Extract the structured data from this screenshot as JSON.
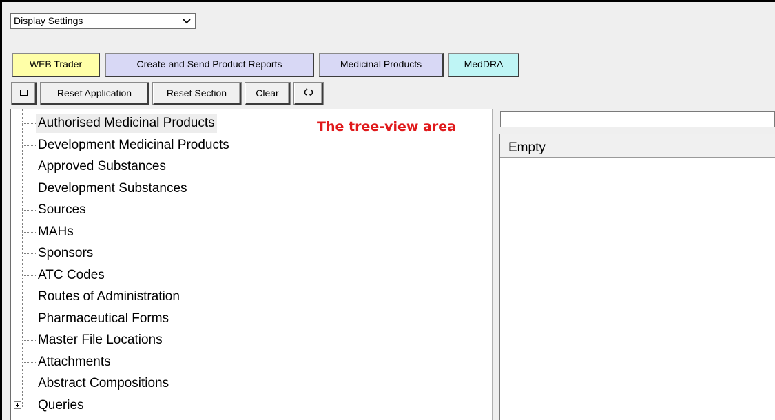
{
  "display_select": {
    "value": "Display Settings",
    "icon": "chevron-down-icon"
  },
  "tabs": [
    {
      "label": "WEB Trader",
      "bg": "#ffffa8"
    },
    {
      "label": "Create and Send Product Reports",
      "bg": "#d8d8f5"
    },
    {
      "label": "Medicinal Products",
      "bg": "#d8d8f5"
    },
    {
      "label": "MedDRA",
      "bg": "#bff5f5"
    }
  ],
  "toolbar": {
    "restore_icon": "square-icon",
    "reset_application": "Reset Application",
    "reset_section": "Reset Section",
    "clear": "Clear",
    "refresh_icon": "cycle-icon"
  },
  "tree": {
    "items": [
      {
        "label": "Authorised Medicinal Products",
        "selected": true
      },
      {
        "label": "Development Medicinal Products"
      },
      {
        "label": "Approved Substances"
      },
      {
        "label": "Development Substances"
      },
      {
        "label": "Sources"
      },
      {
        "label": "MAHs"
      },
      {
        "label": "Sponsors"
      },
      {
        "label": "ATC Codes"
      },
      {
        "label": "Routes of Administration"
      },
      {
        "label": "Pharmaceutical Forms"
      },
      {
        "label": "Master File Locations"
      },
      {
        "label": "Attachments"
      },
      {
        "label": "Abstract Compositions"
      },
      {
        "label": "Queries",
        "expandable": true
      }
    ]
  },
  "annotation": {
    "text": "The tree-view area",
    "color": "#e0191b"
  },
  "right_panel": {
    "search_value": "",
    "list_header": "Empty"
  }
}
